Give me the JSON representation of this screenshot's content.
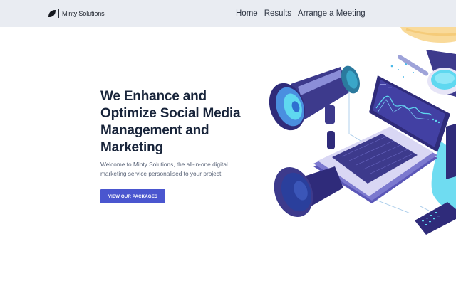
{
  "header": {
    "brand_name": "Minty Solutions",
    "logo_icon": "leaf-icon",
    "nav": [
      {
        "label": "Home"
      },
      {
        "label": "Results"
      },
      {
        "label": "Arrange a Meeting"
      }
    ]
  },
  "hero": {
    "title": "We Enhance and Optimize Social Media Management and Marketing",
    "subtitle": "Welcome to Minty Solutions, the all-in-one digital marketing service personalised to your project.",
    "cta_label": "VIEW OUR PACKAGES",
    "illustration_icon": "megaphone-laptop-illustration"
  },
  "colors": {
    "accent": "#4a56cf",
    "navbar_bg": "#e9ecf2",
    "heading": "#18243a",
    "illustration_purple": "#3d3a8c",
    "illustration_lavender": "#b9b8e8",
    "illustration_cyan": "#5fd8f0",
    "illustration_yellow": "#f8d488"
  }
}
